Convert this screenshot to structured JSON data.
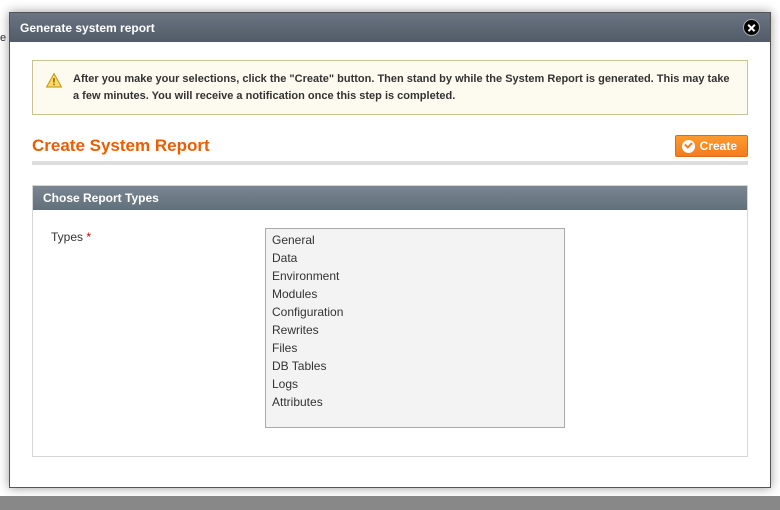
{
  "modal": {
    "title": "Generate system report"
  },
  "notice": {
    "text": "After you make your selections, click the \"Create\" button. Then stand by while the System Report is generated. This may take a few minutes. You will receive a notification once this step is completed."
  },
  "page": {
    "heading": "Create System Report",
    "create_button": "Create"
  },
  "section": {
    "header": "Chose Report Types",
    "field_label": "Types",
    "required_marker": "*"
  },
  "types": [
    "General",
    "Data",
    "Environment",
    "Modules",
    "Configuration",
    "Rewrites",
    "Files",
    "DB Tables",
    "Logs",
    "Attributes"
  ],
  "stray": {
    "e": "e"
  }
}
